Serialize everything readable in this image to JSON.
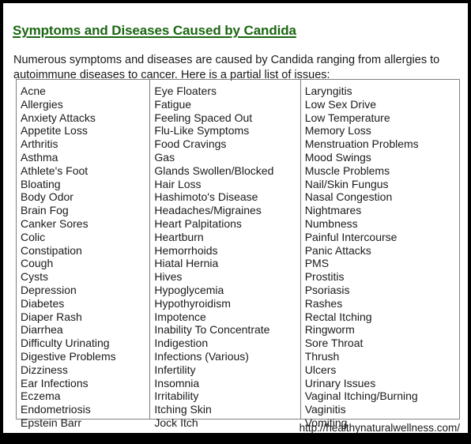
{
  "page": {
    "title": "Symptoms and Diseases Caused by Candida",
    "title_color": "#1a6611",
    "intro": "Numerous symptoms and diseases are caused by Candida ranging from allergies to autoimmune diseases to cancer. Here is a partial list of issues:",
    "footer_url": "http://healthynaturalwellness.com/",
    "border_color": "#808080",
    "frame_color": "#000000",
    "text_color": "#1a1a1a"
  },
  "symptom_table": {
    "columns": [
      {
        "items": [
          "Acne",
          "Allergies",
          "Anxiety Attacks",
          "Appetite Loss",
          "Arthritis",
          "Asthma",
          "Athlete's Foot",
          "Bloating",
          "Body Odor",
          "Brain Fog",
          "Canker Sores",
          "Colic",
          "Constipation",
          "Cough",
          "Cysts",
          "Depression",
          "Diabetes",
          "Diaper Rash",
          "Diarrhea",
          "Difficulty Urinating",
          "Digestive Problems",
          "Dizziness",
          "Ear Infections",
          "Eczema",
          "Endometriosis",
          "Epstein Barr"
        ]
      },
      {
        "items": [
          "Eye Floaters",
          "Fatigue",
          "Feeling Spaced Out",
          "Flu-Like Symptoms",
          "Food Cravings",
          "Gas",
          "Glands Swollen/Blocked",
          "Hair Loss",
          "Hashimoto's Disease",
          "Headaches/Migraines",
          "Heart Palpitations",
          "Heartburn",
          "Hemorrhoids",
          "Hiatal Hernia",
          "Hives",
          "Hypoglycemia",
          "Hypothyroidism",
          "Impotence",
          "Inability To Concentrate",
          "Indigestion",
          "Infections (Various)",
          "Infertility",
          "Insomnia",
          "Irritability",
          "Itching Skin",
          "Jock Itch"
        ]
      },
      {
        "items": [
          "Laryngitis",
          "Low Sex Drive",
          "Low Temperature",
          "Memory Loss",
          "Menstruation Problems",
          "Mood Swings",
          "Muscle Problems",
          "Nail/Skin Fungus",
          "Nasal Congestion",
          "Nightmares",
          "Numbness",
          "Painful Intercourse",
          "Panic Attacks",
          "PMS",
          "Prostitis",
          "Psoriasis",
          "Rashes",
          "Rectal Itching",
          "Ringworm",
          "Sore Throat",
          "Thrush",
          "Ulcers",
          "Urinary Issues",
          "Vaginal Itching/Burning",
          "Vaginitis",
          "Vomiting"
        ]
      }
    ]
  }
}
